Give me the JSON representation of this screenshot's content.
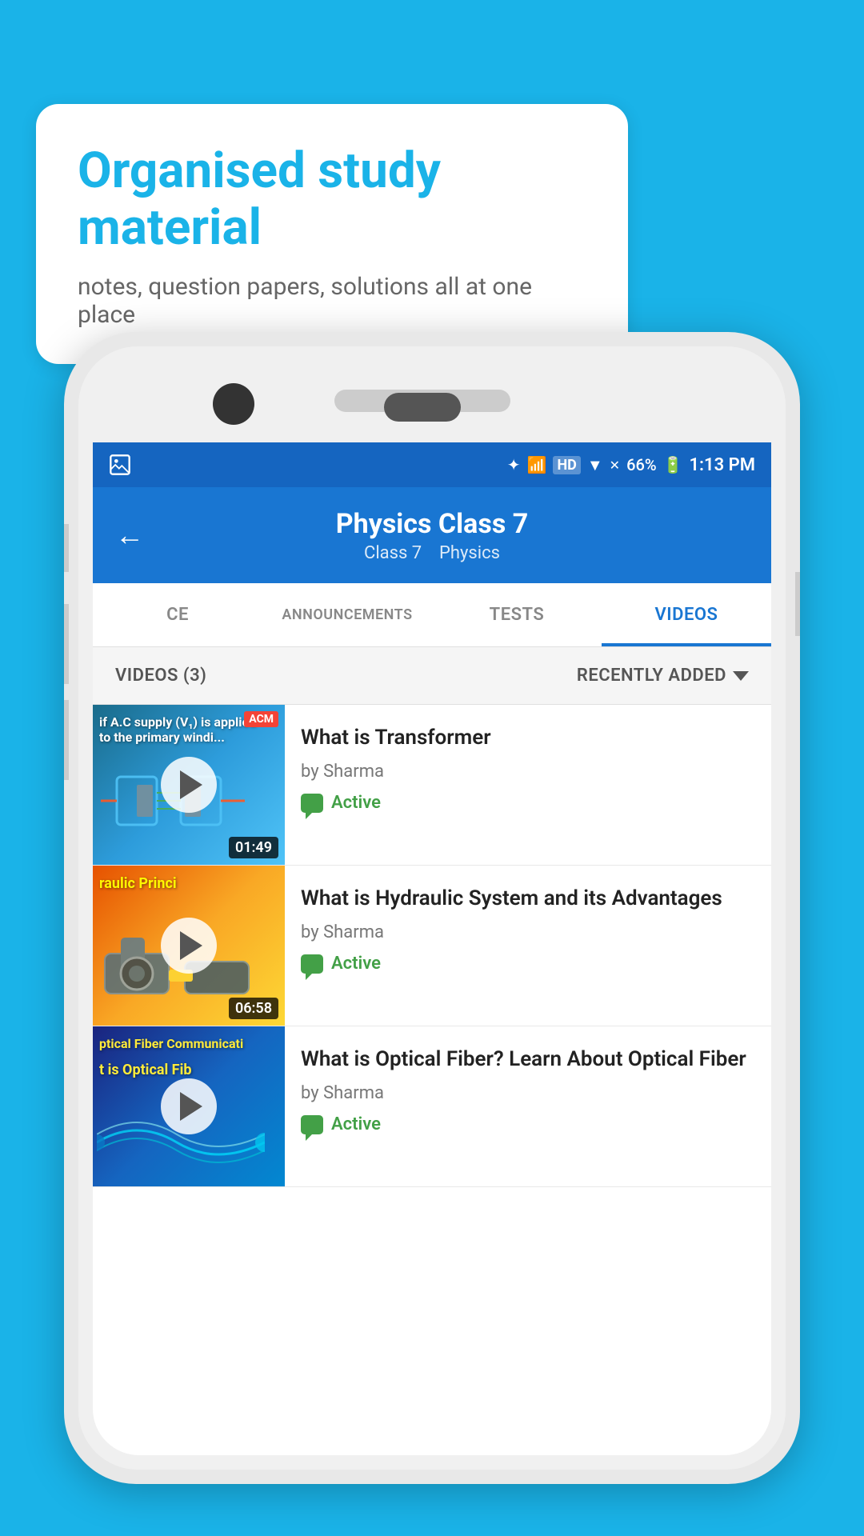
{
  "background": {
    "color": "#1ab3e8"
  },
  "speech_bubble": {
    "title": "Organised study material",
    "subtitle": "notes, question papers, solutions all at one place"
  },
  "phone": {
    "status_bar": {
      "battery": "66%",
      "time": "1:13 PM"
    },
    "app_bar": {
      "back_label": "←",
      "title": "Physics Class 7",
      "subtitle_class": "Class 7",
      "subtitle_subject": "Physics"
    },
    "tabs": [
      {
        "label": "CE",
        "active": false
      },
      {
        "label": "ANNOUNCEMENTS",
        "active": false
      },
      {
        "label": "TESTS",
        "active": false
      },
      {
        "label": "VIDEOS",
        "active": true
      }
    ],
    "filter_bar": {
      "count_label": "VIDEOS (3)",
      "sort_label": "RECENTLY ADDED"
    },
    "videos": [
      {
        "title": "What is  Transformer",
        "author": "by Sharma",
        "status": "Active",
        "duration": "01:49",
        "thumb_label": "AC Supply",
        "acm": "ACM"
      },
      {
        "title": "What is Hydraulic System and its Advantages",
        "author": "by Sharma",
        "status": "Active",
        "duration": "06:58",
        "thumb_label": "Hydraulic Princi"
      },
      {
        "title": "What is Optical Fiber? Learn About Optical Fiber",
        "author": "by Sharma",
        "status": "Active",
        "duration": "",
        "thumb_label": "Optical Fiber Communicati",
        "thumb_label2": "t is Optical Fib"
      }
    ]
  }
}
